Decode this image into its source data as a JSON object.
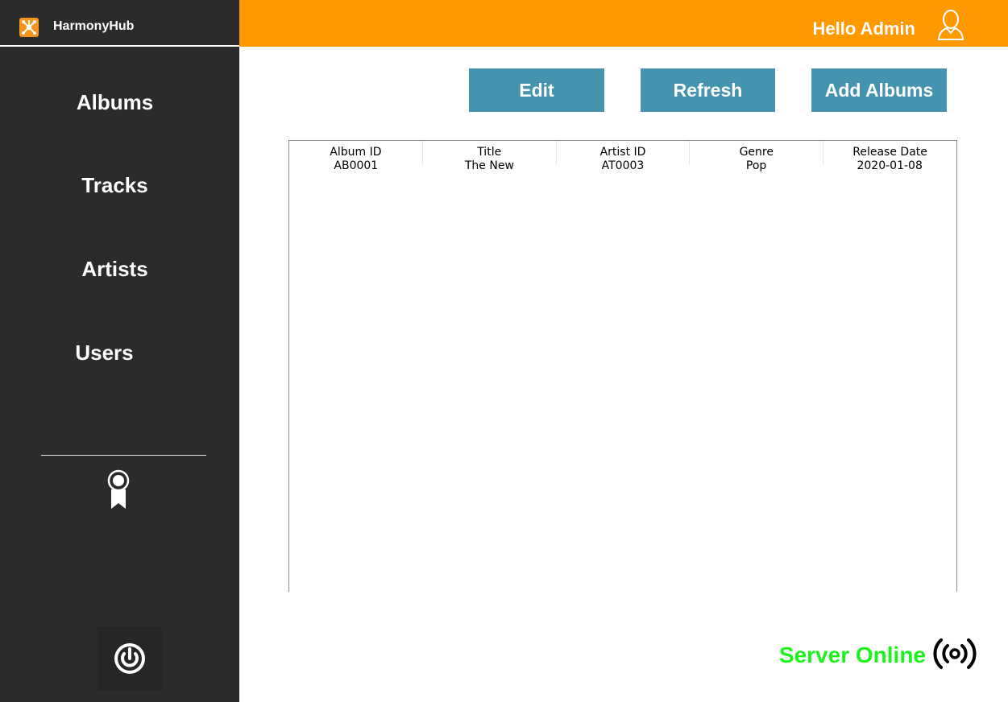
{
  "app": {
    "title": "HarmonyHub",
    "logo_icon": "hub-logo-icon",
    "brand_color": "#f7941d"
  },
  "header": {
    "greeting": "Hello Admin",
    "user_icon": "user-icon",
    "bar_color": "#ff9900"
  },
  "sidebar": {
    "items": [
      {
        "label": "Albums"
      },
      {
        "label": "Tracks"
      },
      {
        "label": "Artists"
      },
      {
        "label": "Users"
      }
    ],
    "badge_icon": "award-icon",
    "power_icon": "power-icon",
    "background": "#2b2b2b"
  },
  "toolbar": {
    "edit_label": "Edit",
    "refresh_label": "Refresh",
    "add_label": "Add Albums",
    "button_color": "#4493af"
  },
  "table": {
    "columns": [
      "Album ID",
      "Title",
      "Artist ID",
      "Genre",
      "Release Date"
    ],
    "rows": [
      [
        "AB0001",
        "The New",
        "AT0003",
        "Pop",
        "2020-01-08"
      ]
    ]
  },
  "status": {
    "text": "Server Online",
    "color": "#1ef21e",
    "icon": "signal-icon"
  }
}
